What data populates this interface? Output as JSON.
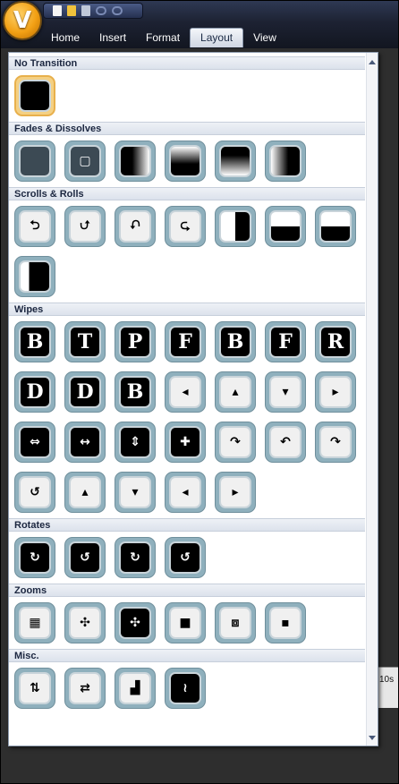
{
  "app": {
    "logo_letter": "V"
  },
  "quick_access": [
    "new-icon",
    "open-folder-icon",
    "save-icon",
    "undo-icon",
    "redo-icon"
  ],
  "ribbon_tabs": [
    {
      "label": "Home"
    },
    {
      "label": "Insert"
    },
    {
      "label": "Format"
    },
    {
      "label": "Layout",
      "active": true
    },
    {
      "label": "View"
    }
  ],
  "timeline": {
    "time_label": "10s"
  },
  "colors": {
    "accent_orb": "#f2a014",
    "tile_border": "#8fb0bd",
    "selected_tile": "#f4d083",
    "header_bg": "#dce2ec"
  },
  "categories": [
    {
      "title": "No Transition",
      "items": [
        {
          "icon": "blank-icon",
          "style": "plain",
          "selected": true
        }
      ]
    },
    {
      "title": "Fades & Dissolves",
      "items": [
        {
          "icon": "dissolve-icon",
          "style": "dissolve"
        },
        {
          "icon": "cross-fade-icon",
          "style": "dissolve",
          "glyph": "▢"
        },
        {
          "icon": "fade-right-icon",
          "style": "fade"
        },
        {
          "icon": "fade-top-icon",
          "style": "fade2"
        },
        {
          "icon": "fade-bottom-icon",
          "style": "fade3"
        },
        {
          "icon": "fade-left-icon",
          "style": "fade4"
        }
      ]
    },
    {
      "title": "Scrolls & Rolls",
      "items": [
        {
          "icon": "scroll-left-icon",
          "style": "light",
          "glyph": "⮌"
        },
        {
          "icon": "scroll-up-icon",
          "style": "light",
          "glyph": "⮍"
        },
        {
          "icon": "scroll-down-icon",
          "style": "light",
          "glyph": "⮏"
        },
        {
          "icon": "scroll-right-icon",
          "style": "light",
          "glyph": "⮎"
        },
        {
          "icon": "roll-vertical-icon",
          "style": "wipe-v"
        },
        {
          "icon": "roll-top-icon",
          "style": "wipe-h"
        },
        {
          "icon": "roll-bottom-icon",
          "style": "wipe-h"
        },
        {
          "icon": "roll-split-icon",
          "style": "split"
        }
      ]
    },
    {
      "title": "Wipes",
      "items": [
        {
          "icon": "wipe-b-icon",
          "style": "plain",
          "glyph": "B"
        },
        {
          "icon": "wipe-t-icon",
          "style": "plain",
          "glyph": "T"
        },
        {
          "icon": "wipe-p-icon",
          "style": "plain",
          "glyph": "P"
        },
        {
          "icon": "wipe-f-icon",
          "style": "plain",
          "glyph": "F"
        },
        {
          "icon": "wipe-b2-icon",
          "style": "plain",
          "glyph": "B"
        },
        {
          "icon": "wipe-f2-icon",
          "style": "plain",
          "glyph": "F"
        },
        {
          "icon": "wipe-r-icon",
          "style": "plain",
          "glyph": "R"
        },
        {
          "icon": "wipe-d-icon",
          "style": "plain",
          "glyph": "D"
        },
        {
          "icon": "wipe-d2-icon",
          "style": "plain",
          "glyph": "D"
        },
        {
          "icon": "wipe-b3-icon",
          "style": "plain",
          "glyph": "B"
        },
        {
          "icon": "wipe-arrow-left-icon",
          "style": "light",
          "glyph": "◂"
        },
        {
          "icon": "wipe-arrow-up-icon",
          "style": "light",
          "glyph": "▴"
        },
        {
          "icon": "wipe-arrow-down-icon",
          "style": "light",
          "glyph": "▾"
        },
        {
          "icon": "wipe-arrow-right-icon",
          "style": "light",
          "glyph": "▸"
        },
        {
          "icon": "barn-split-v-icon",
          "style": "plain",
          "glyph": "⇔"
        },
        {
          "icon": "barn-split-out-icon",
          "style": "plain",
          "glyph": "↔"
        },
        {
          "icon": "barn-split-h-icon",
          "style": "plain",
          "glyph": "⇕"
        },
        {
          "icon": "barn-cross-icon",
          "style": "plain",
          "glyph": "✚"
        },
        {
          "icon": "curl-down-icon",
          "style": "light",
          "glyph": "↷"
        },
        {
          "icon": "curl-left-icon",
          "style": "light",
          "glyph": "↶"
        },
        {
          "icon": "curl-right-icon",
          "style": "light",
          "glyph": "↷"
        },
        {
          "icon": "curl-up-icon",
          "style": "light",
          "glyph": "↺"
        },
        {
          "icon": "blinds-up-icon",
          "style": "light",
          "glyph": "▴"
        },
        {
          "icon": "blinds-down-icon",
          "style": "light",
          "glyph": "▾"
        },
        {
          "icon": "blinds-left-icon",
          "style": "light",
          "glyph": "◂"
        },
        {
          "icon": "blinds-right-icon",
          "style": "light",
          "glyph": "▸"
        }
      ]
    },
    {
      "title": "Rotates",
      "items": [
        {
          "icon": "rotate-1-icon",
          "style": "plain",
          "glyph": "↻"
        },
        {
          "icon": "rotate-2-icon",
          "style": "plain",
          "glyph": "↺"
        },
        {
          "icon": "rotate-3-icon",
          "style": "plain",
          "glyph": "↻"
        },
        {
          "icon": "rotate-4-icon",
          "style": "plain",
          "glyph": "↺"
        }
      ]
    },
    {
      "title": "Zooms",
      "items": [
        {
          "icon": "zoom-checker-icon",
          "style": "light",
          "glyph": "▦"
        },
        {
          "icon": "zoom-out-corners-icon",
          "style": "light",
          "glyph": "✣"
        },
        {
          "icon": "zoom-in-corners-icon",
          "style": "plain",
          "glyph": "✣"
        },
        {
          "icon": "zoom-square-in-icon",
          "style": "light",
          "glyph": "■"
        },
        {
          "icon": "zoom-square-out-icon",
          "style": "light",
          "glyph": "⧈"
        },
        {
          "icon": "zoom-small-icon",
          "style": "light",
          "glyph": "▪"
        }
      ]
    },
    {
      "title": "Misc.",
      "items": [
        {
          "icon": "split-arrows-icon",
          "style": "light",
          "glyph": "⇅"
        },
        {
          "icon": "slide-arrows-icon",
          "style": "light",
          "glyph": "⇄"
        },
        {
          "icon": "stairs-icon",
          "style": "light",
          "glyph": "▟"
        },
        {
          "icon": "wave-icon",
          "style": "plain",
          "glyph": "≀"
        }
      ]
    }
  ]
}
